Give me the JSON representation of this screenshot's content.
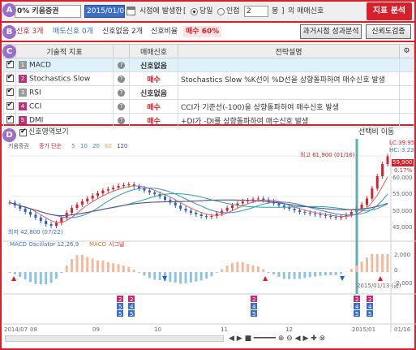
{
  "badges": {
    "a": "A",
    "b": "B",
    "c": "C",
    "d": "D"
  },
  "toolbar": {
    "stock_name": "0% 키움증권",
    "date_value": "2015/01/01",
    "period_label": "시점에 발생한",
    "option_today": "당일",
    "option_range": "인접",
    "range_value": "2",
    "range_unit": "봉",
    "trade_signal_label": "의 매매신호",
    "analyze_button": "지표 분석",
    "bracket_open": "[",
    "bracket_close": "]"
  },
  "summary": {
    "buy_count": "신호 3개",
    "sell_count": "매도신호 0개",
    "none_count": "신호없음 2개",
    "ratio_label": "신호비율",
    "ratio_value": "매수 60%",
    "past_button": "과거시점 성과분석",
    "confidence_button": "신뢰도검증"
  },
  "table": {
    "headers": {
      "indicator": "기술적 지표",
      "signal": "매매신호",
      "description": "전략설명"
    },
    "rows": [
      {
        "num": "1",
        "num_color": "#999999",
        "name": "MACD",
        "signal": "신호없음",
        "signal_type": "none",
        "desc": ""
      },
      {
        "num": "2",
        "num_color": "#c0307a",
        "name": "Stochastics Slow",
        "signal": "매수",
        "signal_type": "buy",
        "desc": "Stochastics Slow %K선이 %D선을 상향돌파하여 매수신호 발생"
      },
      {
        "num": "3",
        "num_color": "#999999",
        "name": "RSI",
        "signal": "신호없음",
        "signal_type": "none",
        "desc": ""
      },
      {
        "num": "4",
        "num_color": "#c0307a",
        "name": "CCI",
        "signal": "매수",
        "signal_type": "buy",
        "desc": "CCI가 기준선(-100)을 상향돌파하여 매수신호 발생"
      },
      {
        "num": "5",
        "num_color": "#c0307a",
        "name": "DMI",
        "signal": "매수",
        "signal_type": "buy",
        "desc": "+DI가 -DI를 상향돌파하여 매수신호 발생"
      }
    ]
  },
  "chart": {
    "show_signal_area": "신호영역보기",
    "select_move": "선택비 이동",
    "legend_stock": "키움증권",
    "legend_ma": "종가 단순",
    "ma_periods": [
      "5",
      "10",
      "20",
      "60",
      "120"
    ],
    "ma_colors": [
      "#e06060",
      "#3a8fd8",
      "#20a8a0",
      "#e0b040",
      "#4a4aa0"
    ],
    "lc_label": "LC:39.95",
    "hc_label": "HC:-3.23",
    "high_label": "최고 61,900 (01/16)",
    "low_label": "최저 42,800 (07/22)",
    "current_price": "59,900",
    "current_change": "0.17%",
    "macd_label": "MACD Oscillator 12,26,9",
    "macd_series": "MACD",
    "signal_series": "시그널",
    "crosshair_date": "2015/01/13 (금)",
    "price_axis": [
      "60,000",
      "55,000",
      "50,000",
      "45,000"
    ],
    "macd_axis": [
      "2,000",
      "0",
      "-2,000"
    ],
    "date_axis": [
      "2014/07",
      "08",
      "09",
      "10",
      "11",
      "12",
      "2015/01",
      "01/16"
    ]
  },
  "chart_data": {
    "type": "candlestick",
    "ylim": [
      40000,
      63000
    ],
    "high": 61900,
    "low": 42800,
    "close_series": [
      48500,
      47800,
      47000,
      46200,
      45500,
      44800,
      44000,
      43200,
      42800,
      43500,
      44800,
      46000,
      47200,
      48000,
      48800,
      49500,
      50200,
      50800,
      51500,
      51800,
      52200,
      52600,
      52800,
      53000,
      52500,
      52000,
      51500,
      51000,
      50600,
      50000,
      49200,
      48500,
      47800,
      47000,
      46500,
      46000,
      45600,
      45200,
      45000,
      45200,
      45800,
      46500,
      47200,
      47800,
      48300,
      48800,
      49000,
      49300,
      49500,
      49200,
      48800,
      48300,
      47800,
      47400,
      47000,
      46600,
      46200,
      46000,
      45800,
      45600,
      45400,
      45200,
      45000,
      44800,
      45000,
      45500,
      46200,
      47000,
      48000,
      49500,
      52000,
      55000,
      58000,
      59900
    ]
  }
}
